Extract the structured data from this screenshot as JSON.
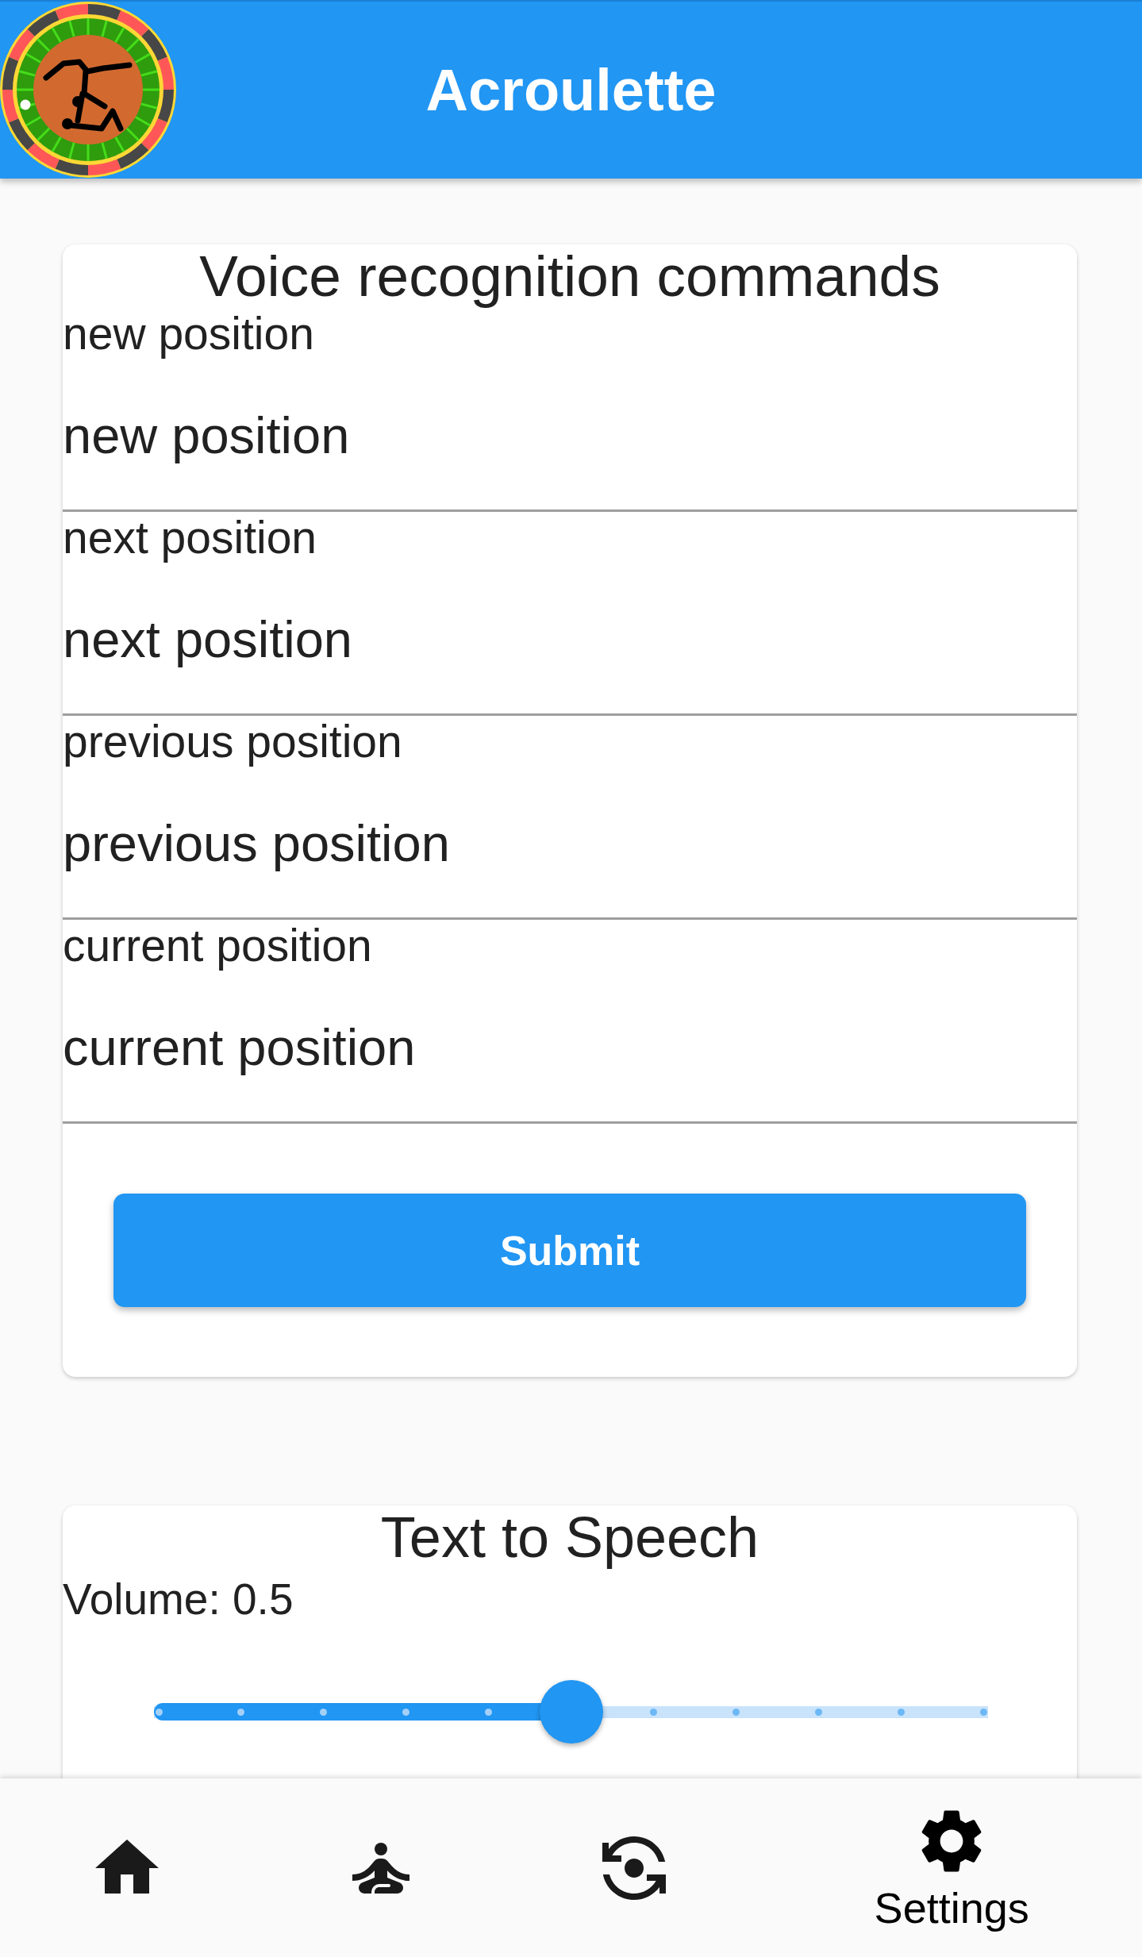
{
  "app_bar": {
    "title": "Acroulette"
  },
  "voice_commands": {
    "title": "Voice recognition commands",
    "fields": [
      {
        "label": "new position",
        "value": "new position"
      },
      {
        "label": "next position",
        "value": "next position"
      },
      {
        "label": "previous position",
        "value": "previous position"
      },
      {
        "label": "current position",
        "value": "current position"
      }
    ],
    "submit": "Submit"
  },
  "text_to_speech": {
    "title": "Text to Speech",
    "volume_label": "Volume: 0.5",
    "volume": {
      "level": 0.5
    }
  },
  "bottom_nav": [
    {
      "kind": "home",
      "selected": false
    },
    {
      "kind": "meditation",
      "selected": false
    },
    {
      "kind": "camera_switch",
      "selected": false
    },
    {
      "kind": "settings",
      "selected": true,
      "label": "Settings"
    }
  ]
}
